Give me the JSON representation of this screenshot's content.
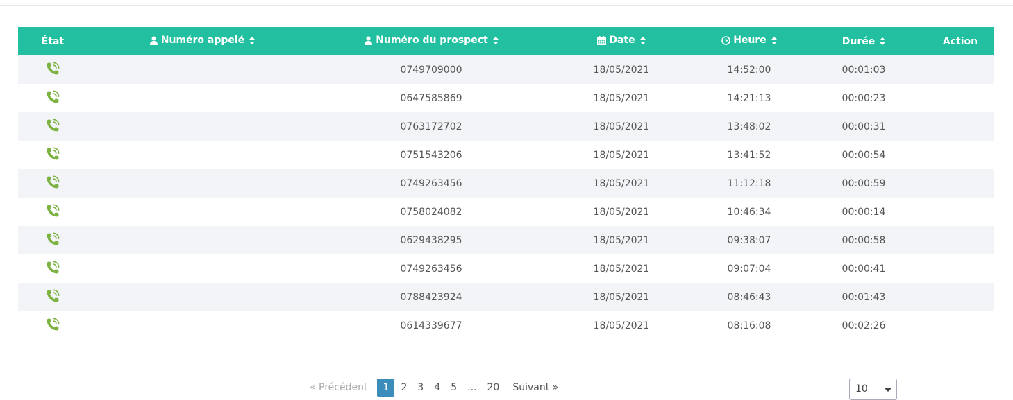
{
  "table": {
    "headers": {
      "etat": "État",
      "numero_appele": "Numéro appelé",
      "numero_prospect": "Numéro du prospect",
      "date": "Date",
      "heure": "Heure",
      "duree": "Durée",
      "action": "Action"
    },
    "rows": [
      {
        "numero_appele": "",
        "numero_prospect": "0749709000",
        "date": "18/05/2021",
        "heure": "14:52:00",
        "duree": "00:01:03",
        "action": ""
      },
      {
        "numero_appele": "",
        "numero_prospect": "0647585869",
        "date": "18/05/2021",
        "heure": "14:21:13",
        "duree": "00:00:23",
        "action": ""
      },
      {
        "numero_appele": "",
        "numero_prospect": "0763172702",
        "date": "18/05/2021",
        "heure": "13:48:02",
        "duree": "00:00:31",
        "action": ""
      },
      {
        "numero_appele": "",
        "numero_prospect": "0751543206",
        "date": "18/05/2021",
        "heure": "13:41:52",
        "duree": "00:00:54",
        "action": ""
      },
      {
        "numero_appele": "",
        "numero_prospect": "0749263456",
        "date": "18/05/2021",
        "heure": "11:12:18",
        "duree": "00:00:59",
        "action": ""
      },
      {
        "numero_appele": "",
        "numero_prospect": "0758024082",
        "date": "18/05/2021",
        "heure": "10:46:34",
        "duree": "00:00:14",
        "action": ""
      },
      {
        "numero_appele": "",
        "numero_prospect": "0629438295",
        "date": "18/05/2021",
        "heure": "09:38:07",
        "duree": "00:00:58",
        "action": ""
      },
      {
        "numero_appele": "",
        "numero_prospect": "0749263456",
        "date": "18/05/2021",
        "heure": "09:07:04",
        "duree": "00:00:41",
        "action": ""
      },
      {
        "numero_appele": "",
        "numero_prospect": "0788423924",
        "date": "18/05/2021",
        "heure": "08:46:43",
        "duree": "00:01:43",
        "action": ""
      },
      {
        "numero_appele": "",
        "numero_prospect": "0614339677",
        "date": "18/05/2021",
        "heure": "08:16:08",
        "duree": "00:02:26",
        "action": ""
      }
    ],
    "status_icon": "phone-call-icon",
    "status_color": "#7cb342",
    "header_color": "#22c0a0"
  },
  "pagination": {
    "prev": "«  Précédent",
    "pages": [
      "1",
      "2",
      "3",
      "4",
      "5",
      "...",
      "20"
    ],
    "active": "1",
    "next": "Suivant  »",
    "active_color": "#3c8dbc"
  },
  "per_page": {
    "value": "10"
  }
}
